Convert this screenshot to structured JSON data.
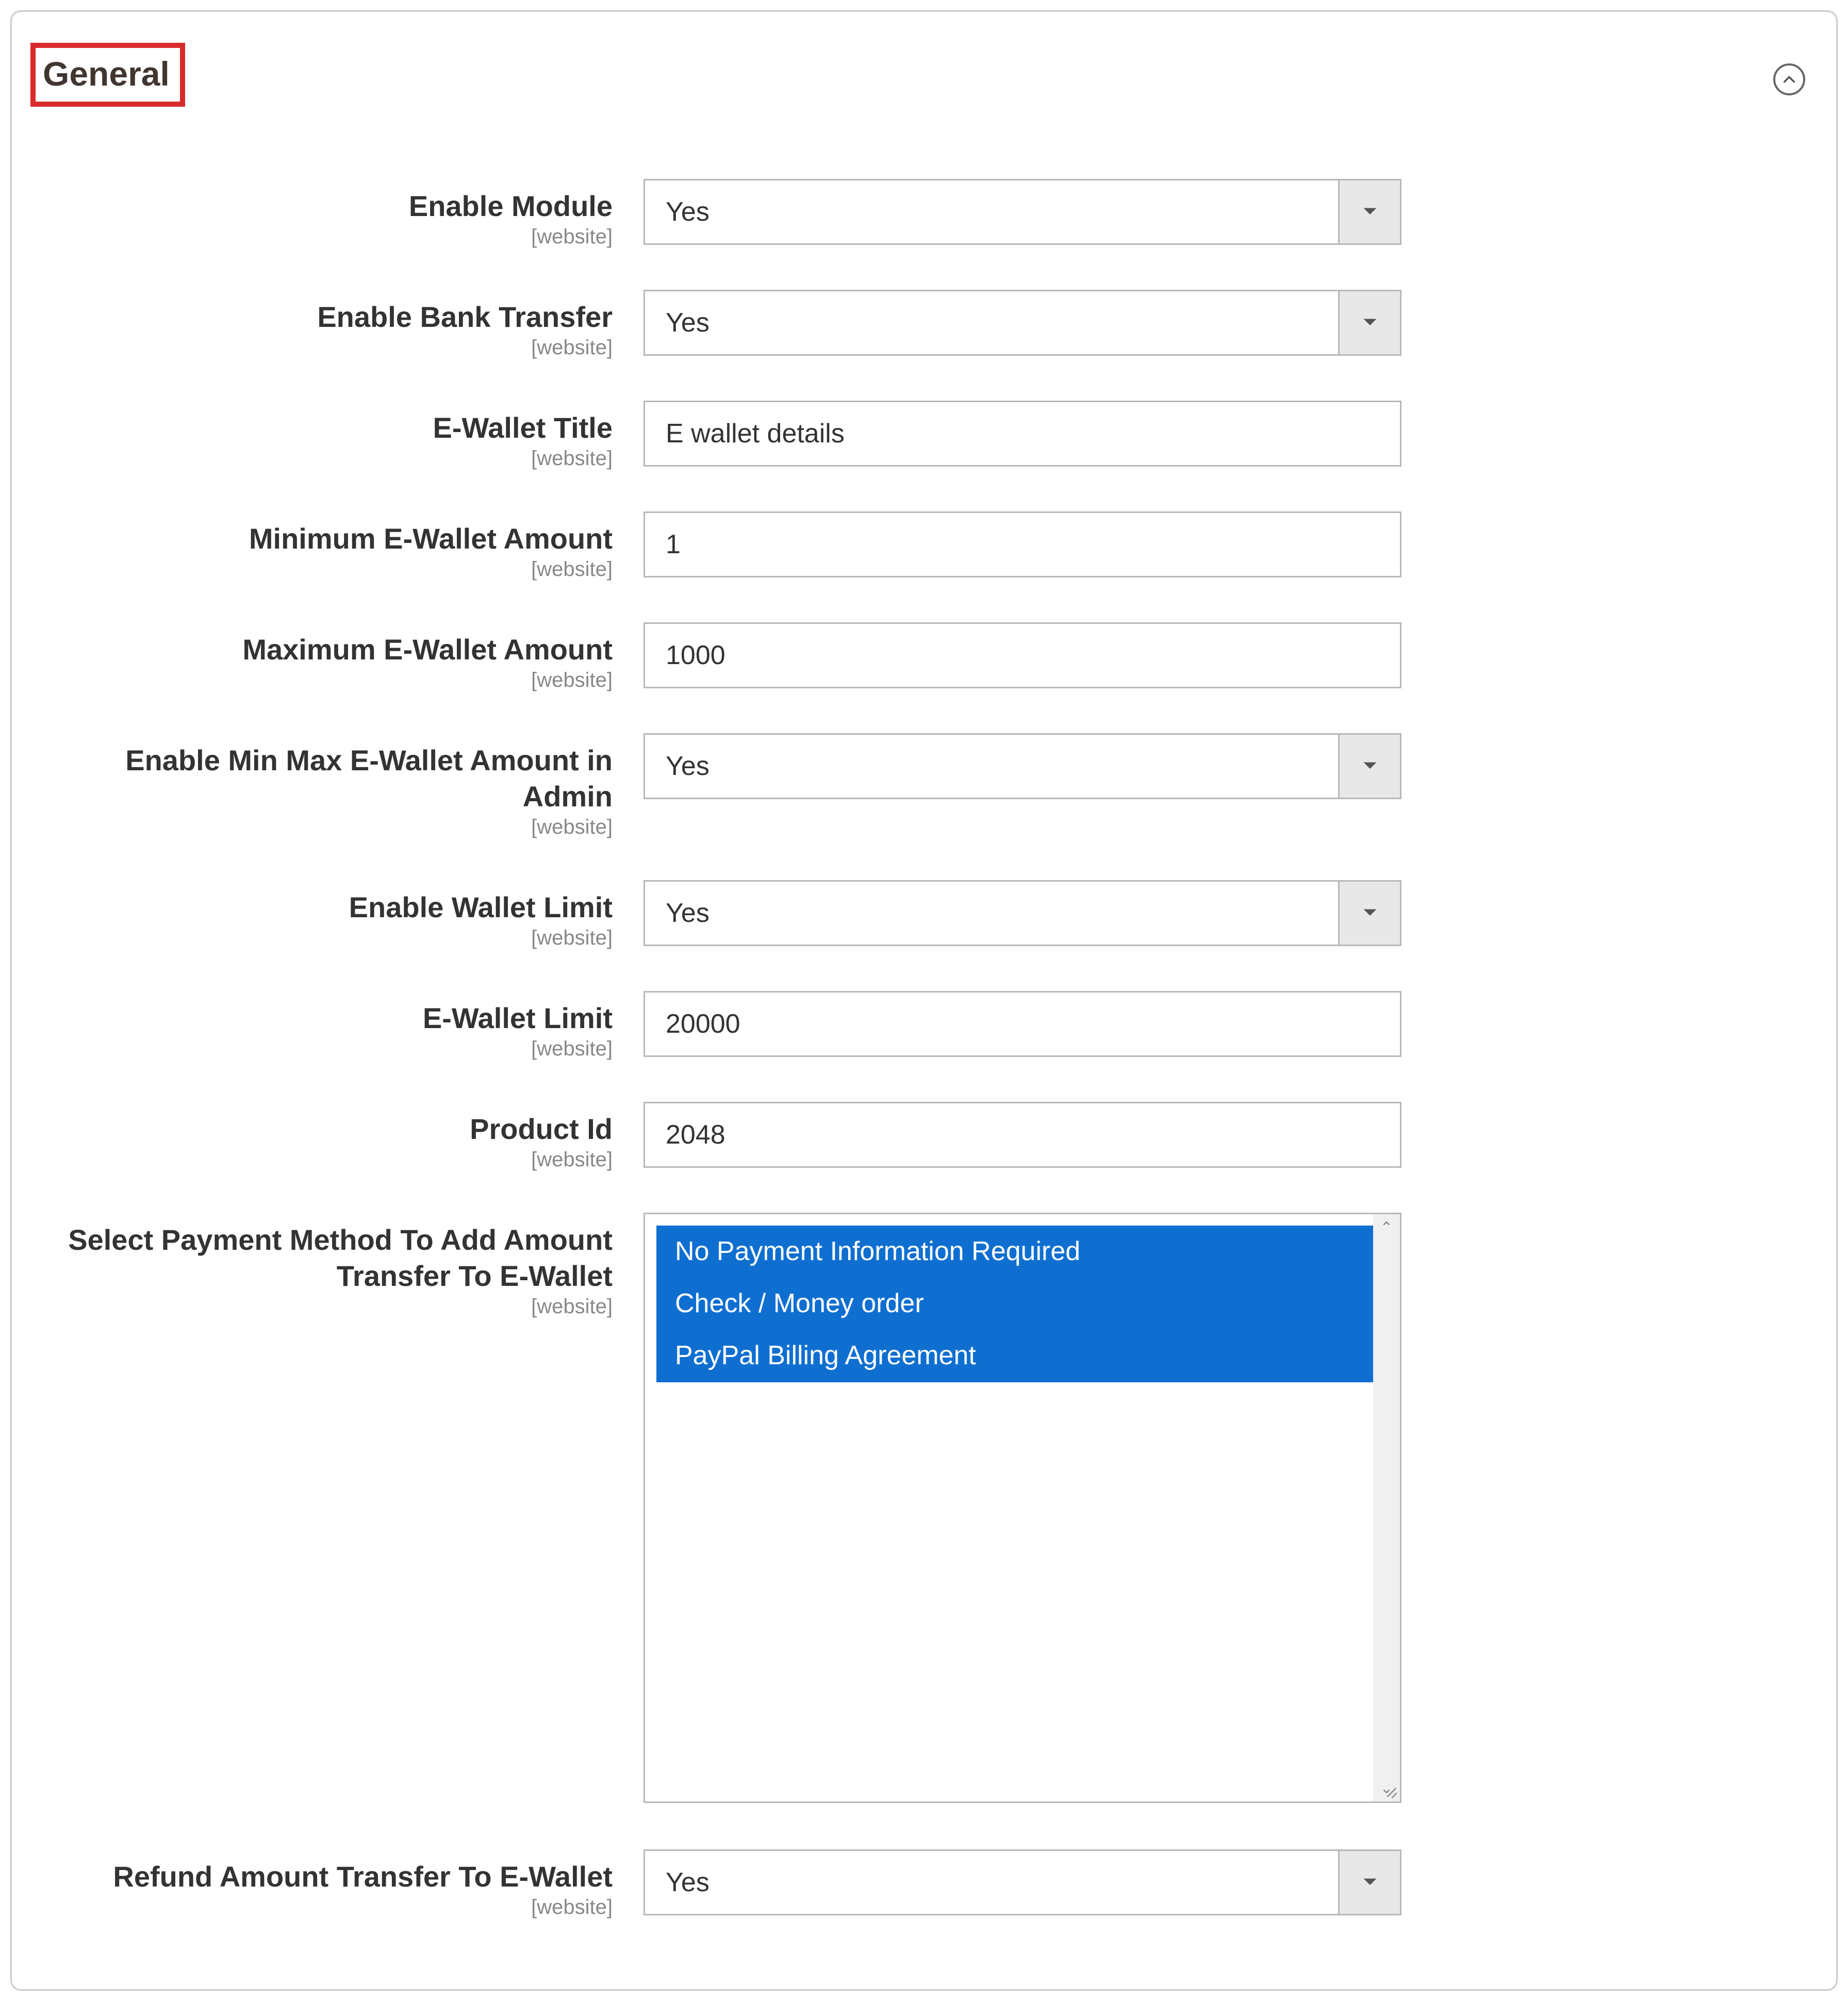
{
  "section": {
    "title": "General",
    "scopeText": "[website]"
  },
  "fields": {
    "enableModule": {
      "label": "Enable Module",
      "value": "Yes"
    },
    "enableBankTransfer": {
      "label": "Enable Bank Transfer",
      "value": "Yes"
    },
    "ewalletTitle": {
      "label": "E-Wallet Title",
      "value": "E wallet details"
    },
    "minAmount": {
      "label": "Minimum E-Wallet Amount",
      "value": "1"
    },
    "maxAmount": {
      "label": "Maximum E-Wallet Amount",
      "value": "1000"
    },
    "enableMinMaxAdmin": {
      "label": "Enable Min Max E-Wallet Amount in Admin",
      "value": "Yes"
    },
    "enableWalletLimit": {
      "label": "Enable Wallet Limit",
      "value": "Yes"
    },
    "ewalletLimit": {
      "label": "E-Wallet Limit",
      "value": "20000"
    },
    "productId": {
      "label": "Product Id",
      "value": "2048"
    },
    "paymentMethods": {
      "label": "Select Payment Method To Add Amount Transfer To E-Wallet",
      "options": [
        "No Payment Information Required",
        "Check / Money order",
        "PayPal Billing Agreement"
      ]
    },
    "refundTransfer": {
      "label": "Refund Amount Transfer To E-Wallet",
      "value": "Yes"
    }
  }
}
